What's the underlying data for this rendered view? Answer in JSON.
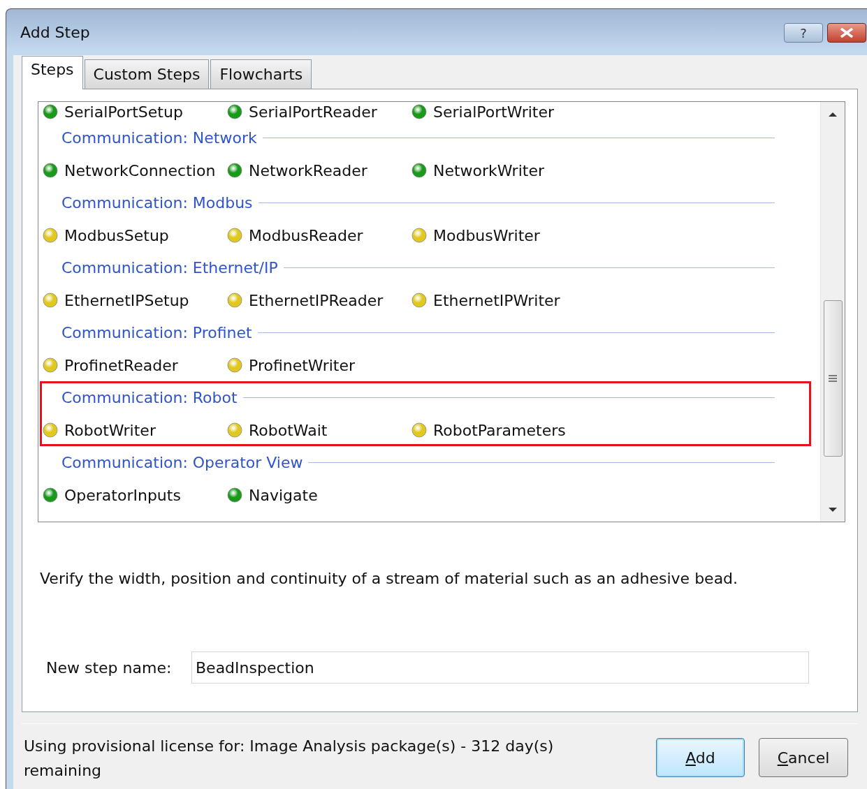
{
  "window": {
    "title": "Add Step",
    "help_button": "?"
  },
  "tabs": [
    {
      "label": "Steps",
      "selected": true
    },
    {
      "label": "Custom Steps",
      "selected": false
    },
    {
      "label": "Flowcharts",
      "selected": false
    }
  ],
  "step_list": {
    "groups": [
      {
        "items": [
          {
            "label": "SerialPortSetup",
            "color": "#1a9a1a"
          },
          {
            "label": "SerialPortReader",
            "color": "#1a9a1a"
          },
          {
            "label": "SerialPortWriter",
            "color": "#1a9a1a"
          }
        ],
        "highlighted": false
      },
      {
        "header": "Communication: Network",
        "highlighted": false,
        "items": [
          {
            "label": "NetworkConnection",
            "color": "#1a9a1a"
          },
          {
            "label": "NetworkReader",
            "color": "#1a9a1a"
          },
          {
            "label": "NetworkWriter",
            "color": "#1a9a1a"
          }
        ]
      },
      {
        "header": "Communication: Modbus",
        "highlighted": false,
        "items": [
          {
            "label": "ModbusSetup",
            "color": "#e0c820"
          },
          {
            "label": "ModbusReader",
            "color": "#e0c820"
          },
          {
            "label": "ModbusWriter",
            "color": "#e0c820"
          }
        ]
      },
      {
        "header": "Communication: Ethernet/IP",
        "highlighted": false,
        "items": [
          {
            "label": "EthernetIPSetup",
            "color": "#e0c820"
          },
          {
            "label": "EthernetIPReader",
            "color": "#e0c820"
          },
          {
            "label": "EthernetIPWriter",
            "color": "#e0c820"
          }
        ]
      },
      {
        "header": "Communication: Profinet",
        "highlighted": false,
        "items": [
          {
            "label": "ProfinetReader",
            "color": "#e0c820"
          },
          {
            "label": "ProfinetWriter",
            "color": "#e0c820"
          }
        ]
      },
      {
        "header": "Communication: Robot",
        "highlighted": true,
        "items": [
          {
            "label": "RobotWriter",
            "color": "#e0c820"
          },
          {
            "label": "RobotWait",
            "color": "#e0c820"
          },
          {
            "label": "RobotParameters",
            "color": "#e0c820"
          }
        ]
      },
      {
        "header": "Communication: Operator View",
        "highlighted": false,
        "items": [
          {
            "label": "OperatorInputs",
            "color": "#1a9a1a"
          },
          {
            "label": "Navigate",
            "color": "#1a9a1a"
          }
        ]
      }
    ]
  },
  "description": "Verify the width, position and continuity of a stream of material such as an adhesive bead.",
  "name_field": {
    "label": "New step name:",
    "value": "BeadInspection"
  },
  "status": "Using provisional license for: Image Analysis package(s) - 312 day(s) remaining",
  "buttons": [
    {
      "label": "Add",
      "default": true
    },
    {
      "label": "Cancel",
      "default": false
    }
  ]
}
